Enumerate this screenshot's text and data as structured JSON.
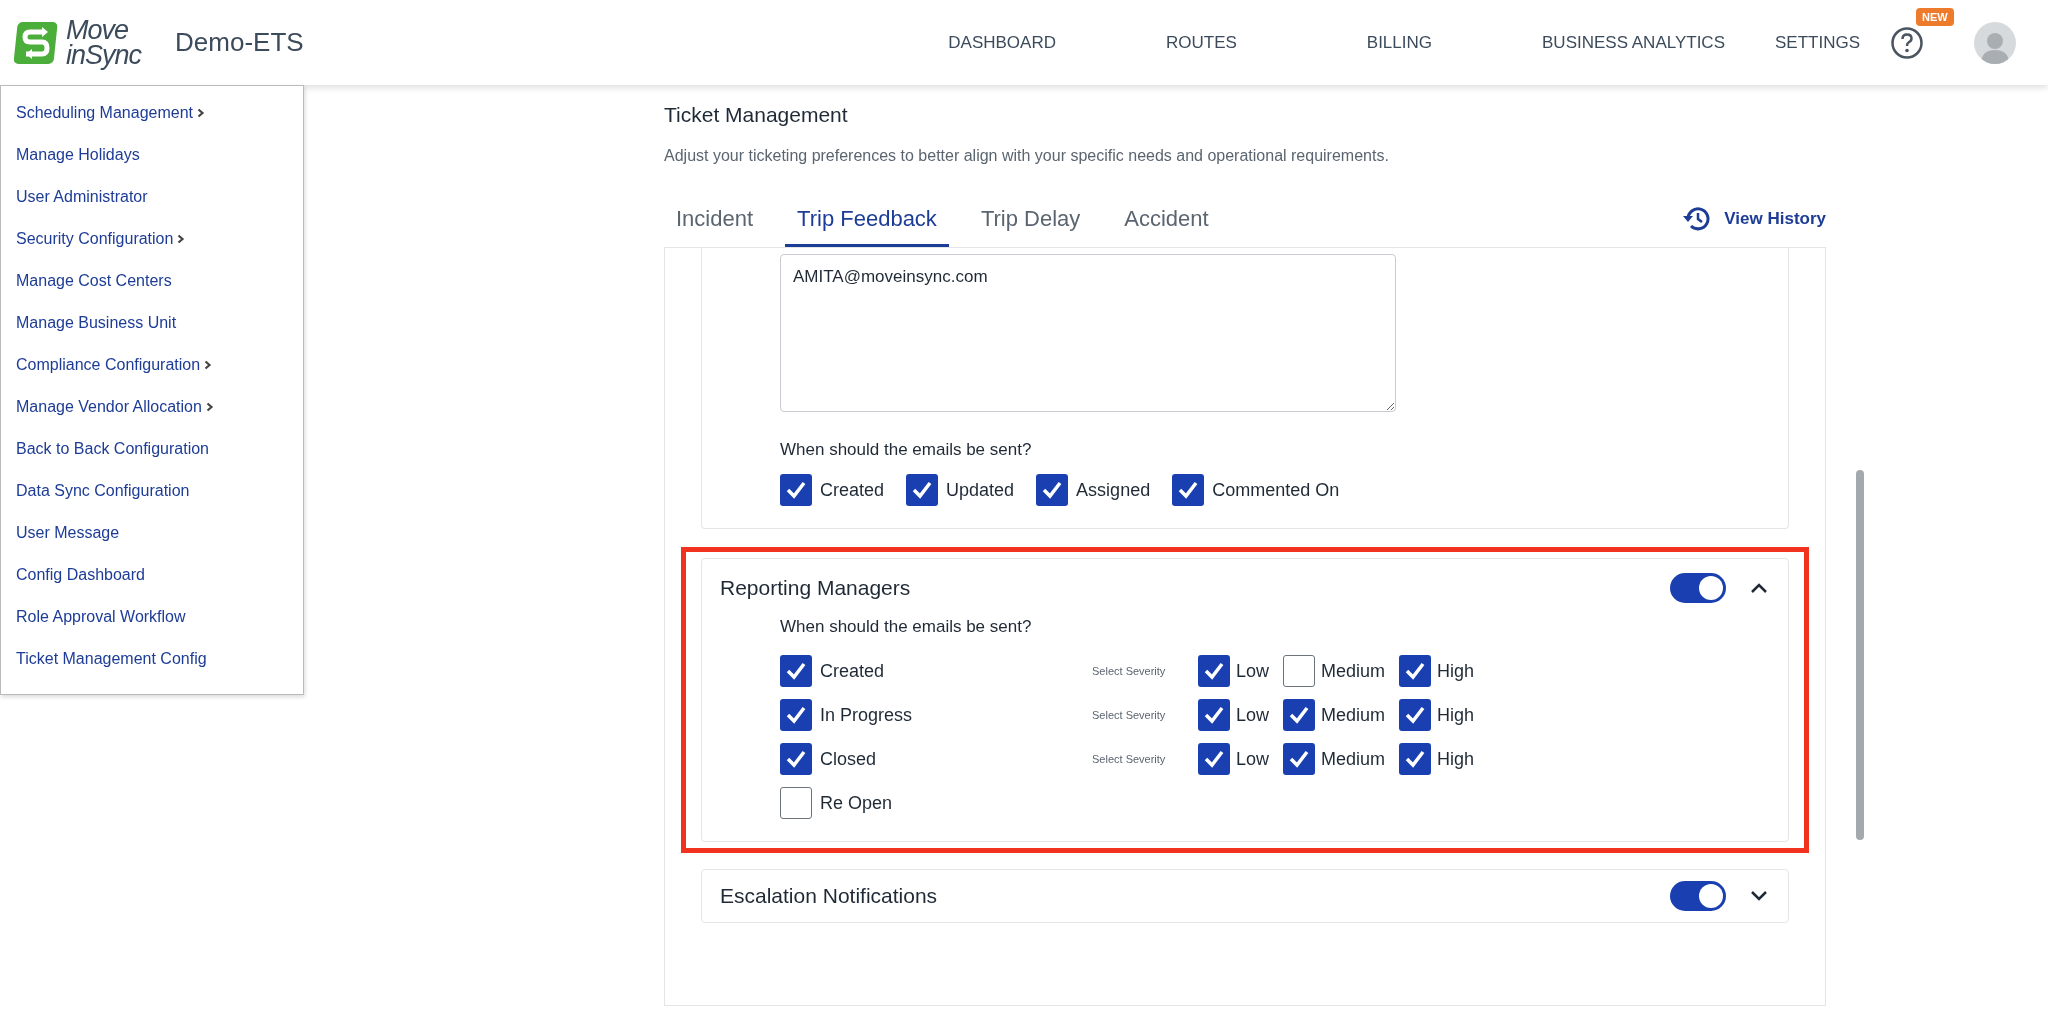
{
  "header": {
    "logo": {
      "line_1": "Move",
      "line_2": "inSync"
    },
    "org": "Demo-ETS",
    "nav": [
      {
        "label": "DASHBOARD"
      },
      {
        "label": "ROUTES"
      },
      {
        "label": "BILLING"
      },
      {
        "label": "BUSINESS ANALYTICS"
      },
      {
        "label": "SETTINGS"
      }
    ],
    "help_badge": "NEW"
  },
  "sidebar": {
    "items": [
      {
        "label": "Scheduling Management",
        "has_submenu": true
      },
      {
        "label": "Manage Holidays",
        "has_submenu": false
      },
      {
        "label": "User Administrator",
        "has_submenu": false
      },
      {
        "label": "Security Configuration",
        "has_submenu": true
      },
      {
        "label": "Manage Cost Centers",
        "has_submenu": false
      },
      {
        "label": "Manage Business Unit",
        "has_submenu": false
      },
      {
        "label": "Compliance Configuration",
        "has_submenu": true
      },
      {
        "label": "Manage Vendor Allocation",
        "has_submenu": true
      },
      {
        "label": "Back to Back Configuration",
        "has_submenu": false
      },
      {
        "label": "Data Sync Configuration",
        "has_submenu": false
      },
      {
        "label": "User Message",
        "has_submenu": false
      },
      {
        "label": "Config Dashboard",
        "has_submenu": false
      },
      {
        "label": "Role Approval Workflow",
        "has_submenu": false
      },
      {
        "label": "Ticket Management Config",
        "has_submenu": false
      }
    ]
  },
  "page": {
    "title": "Ticket Management",
    "subtitle": "Adjust your ticketing preferences to better align with your specific needs and operational requirements.",
    "tabs": [
      {
        "label": "Incident",
        "selected": false
      },
      {
        "label": "Trip Feedback",
        "selected": true
      },
      {
        "label": "Trip Delay",
        "selected": false
      },
      {
        "label": "Accident",
        "selected": false
      }
    ],
    "view_history": "View History"
  },
  "email_card": {
    "emails": "AMITA@moveinsync.com",
    "question": "When should the emails be sent?",
    "options": [
      {
        "label": "Created",
        "checked": true
      },
      {
        "label": "Updated",
        "checked": true
      },
      {
        "label": "Assigned",
        "checked": true
      },
      {
        "label": "Commented On",
        "checked": true
      }
    ]
  },
  "reporting_managers": {
    "title": "Reporting Managers",
    "on": true,
    "expanded": true,
    "highlighted": true,
    "question": "When should the emails be sent?",
    "rows": [
      {
        "label": "Created",
        "checked": true,
        "severity_label": "Select Severity",
        "severities": [
          {
            "label": "Low",
            "checked": true
          },
          {
            "label": "Medium",
            "checked": false
          },
          {
            "label": "High",
            "checked": true
          }
        ]
      },
      {
        "label": "In Progress",
        "checked": true,
        "severity_label": "Select Severity",
        "severities": [
          {
            "label": "Low",
            "checked": true
          },
          {
            "label": "Medium",
            "checked": true
          },
          {
            "label": "High",
            "checked": true
          }
        ]
      },
      {
        "label": "Closed",
        "checked": true,
        "severity_label": "Select Severity",
        "severities": [
          {
            "label": "Low",
            "checked": true
          },
          {
            "label": "Medium",
            "checked": true
          },
          {
            "label": "High",
            "checked": true
          }
        ]
      },
      {
        "label": "Re Open",
        "checked": false
      }
    ]
  },
  "escalation_notifications": {
    "title": "Escalation Notifications",
    "on": true,
    "expanded": false
  }
}
